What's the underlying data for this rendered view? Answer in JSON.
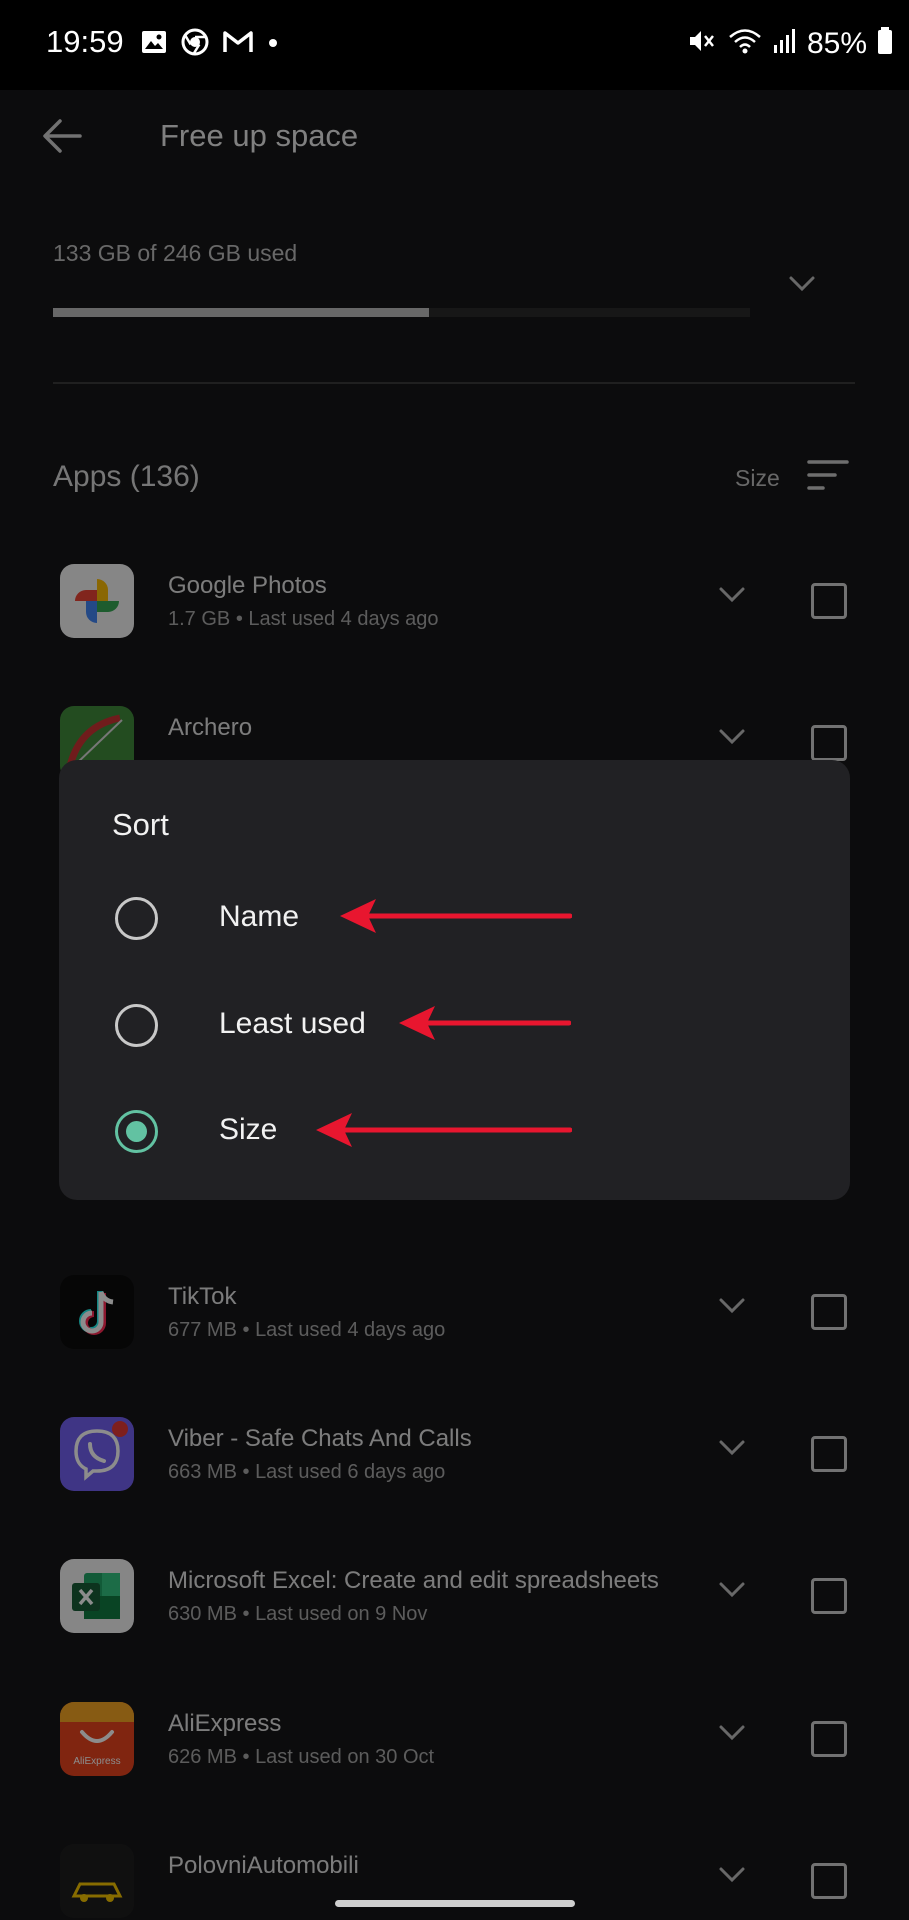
{
  "status_bar": {
    "time": "19:59",
    "battery": "85%",
    "left_icons": [
      "gallery-icon",
      "chrome-icon",
      "gmail-icon",
      "dot-icon"
    ],
    "right_icons": [
      "mute-icon",
      "wifi-icon",
      "signal-icon",
      "battery-icon"
    ]
  },
  "header": {
    "title": "Free up space",
    "back_icon": "back-arrow-icon"
  },
  "storage": {
    "summary": "133 GB of 246 GB used",
    "used_fraction": 0.54
  },
  "apps_section": {
    "title": "Apps (136)",
    "sort_label": "Size"
  },
  "apps": [
    {
      "name": "Google Photos",
      "size": "1.7 GB",
      "last_used": "Last used 4 days ago",
      "icon": "google-photos-icon"
    },
    {
      "name": "Archero",
      "size": "",
      "last_used": "",
      "icon": "archero-icon"
    },
    {
      "name": "TikTok",
      "size": "677 MB",
      "last_used": "Last used 4 days ago",
      "icon": "tiktok-icon"
    },
    {
      "name": "Viber - Safe Chats And Calls",
      "size": "663 MB",
      "last_used": "Last used 6 days ago",
      "icon": "viber-icon"
    },
    {
      "name": "Microsoft Excel: Create and edit spreadsheets",
      "size": "630 MB",
      "last_used": "Last used on 9 Nov",
      "icon": "excel-icon"
    },
    {
      "name": "AliExpress",
      "size": "626 MB",
      "last_used": "Last used on 30 Oct",
      "icon": "aliexpress-icon"
    },
    {
      "name": "PolovniAutomobili",
      "size": "",
      "last_used": "",
      "icon": "polovniautomobili-icon"
    }
  ],
  "sort_dialog": {
    "title": "Sort",
    "options": [
      {
        "label": "Name",
        "selected": false
      },
      {
        "label": "Least used",
        "selected": false
      },
      {
        "label": "Size",
        "selected": true
      }
    ]
  },
  "annotation_color": "#e8162f"
}
